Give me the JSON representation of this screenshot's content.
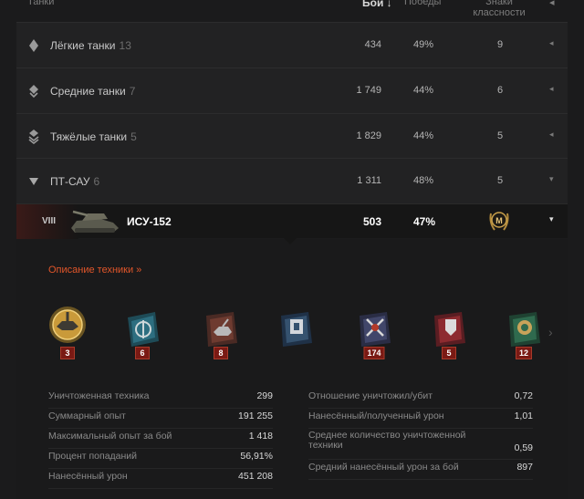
{
  "header": {
    "tanks": "Танки",
    "battles": "Бой ↓",
    "wins": "Победы",
    "mastery": "Знаки классности"
  },
  "groups": [
    {
      "name": "Лёгкие танки",
      "count": "13",
      "battles": "434",
      "wins": "49%",
      "mastery": "9",
      "icon": "light-tank-icon",
      "toggle": "◂"
    },
    {
      "name": "Средние танки",
      "count": "7",
      "battles": "1 749",
      "wins": "44%",
      "mastery": "6",
      "icon": "medium-tank-icon",
      "toggle": "◂"
    },
    {
      "name": "Тяжёлые танки",
      "count": "5",
      "battles": "1 829",
      "wins": "44%",
      "mastery": "5",
      "icon": "heavy-tank-icon",
      "toggle": "◂"
    },
    {
      "name": "ПТ-САУ",
      "count": "6",
      "battles": "1 311",
      "wins": "48%",
      "mastery": "5",
      "icon": "td-icon",
      "toggle": "▾"
    }
  ],
  "vehicle": {
    "tier": "VIII",
    "name": "ИСУ-152",
    "battles": "503",
    "wins": "47%",
    "mastery_badge": "M",
    "toggle": "▾"
  },
  "detail": {
    "description_link": "Описание техники",
    "description_arrow": "»"
  },
  "medals": [
    {
      "icon": "mastery-medal-icon",
      "count": "3"
    },
    {
      "icon": "sniper-medal-icon",
      "count": "6"
    },
    {
      "icon": "invader-medal-icon",
      "count": "8"
    },
    {
      "icon": "defender-medal-icon",
      "count": ""
    },
    {
      "icon": "warrior-medal-icon",
      "count": "174"
    },
    {
      "icon": "steel-wall-medal-icon",
      "count": "5"
    },
    {
      "icon": "supporter-medal-icon",
      "count": "12"
    }
  ],
  "stats_left": [
    {
      "label": "Уничтоженная техника",
      "value": "299"
    },
    {
      "label": "Суммарный опыт",
      "value": "191 255"
    },
    {
      "label": "Максимальный опыт за бой",
      "value": "1 418"
    },
    {
      "label": "Процент попаданий",
      "value": "56,91%"
    },
    {
      "label": "Нанесённый урон",
      "value": "451 208"
    }
  ],
  "stats_right": [
    {
      "label": "Отношение уничтожил/убит",
      "value": "0,72"
    },
    {
      "label": "Нанесённый/полученный урон",
      "value": "1,01"
    },
    {
      "label": "Среднее количество уничтоженной техники",
      "value": "0,59"
    },
    {
      "label": "Средний нанесённый урон за бой",
      "value": "897"
    }
  ],
  "colors": {
    "accent": "#e2562a",
    "badge": "#7a1a14",
    "background": "#1b1b1c"
  }
}
